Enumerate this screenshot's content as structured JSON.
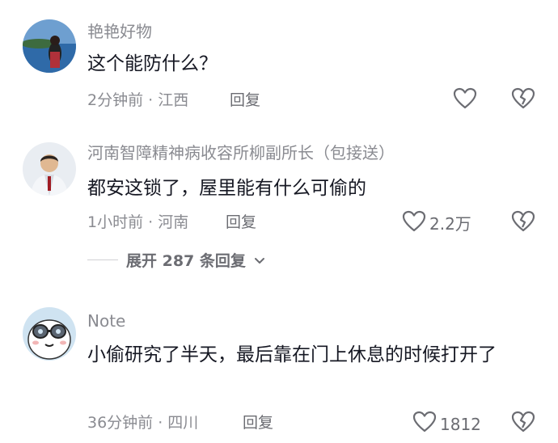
{
  "comments": [
    {
      "username": "艳艳好物",
      "content": "这个能防什么？",
      "meta": "2分钟前 · 江西",
      "reply_label": "回复",
      "like_count": "",
      "like_icon": "heart-outline-icon",
      "dislike_icon": "broken-heart-icon"
    },
    {
      "username": "河南智障精神病收容所柳副所长（包接送）",
      "content": "都安这锁了，屋里能有什么可偷的",
      "meta": "1小时前 · 河南",
      "reply_label": "回复",
      "like_count": "2.2万",
      "like_icon": "heart-outline-icon",
      "dislike_icon": "broken-heart-icon",
      "expand_label": "展开 287 条回复"
    },
    {
      "username": "Note",
      "content": "小偷研究了半天，最后靠在门上休息的时候打开了",
      "meta": "36分钟前 · 四川",
      "reply_label": "回复",
      "like_count": "1812",
      "like_icon": "heart-outline-icon",
      "dislike_icon": "broken-heart-icon"
    }
  ],
  "colors": {
    "text_primary": "#161823",
    "text_secondary": "#8a8b91",
    "icon": "#6b6c72"
  }
}
